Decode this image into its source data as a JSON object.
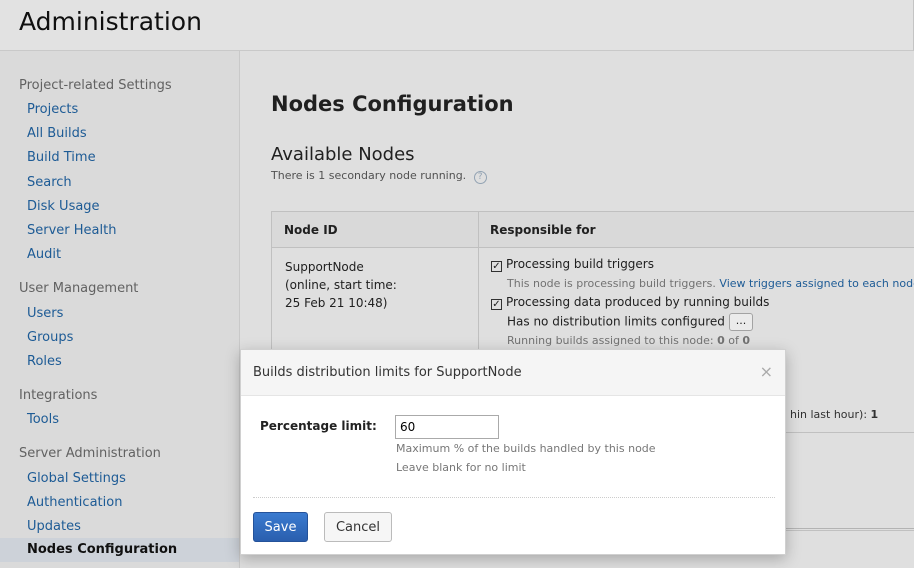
{
  "header": {
    "title": "Administration"
  },
  "sidebar": {
    "sections": [
      {
        "title": "Project-related Settings",
        "items": [
          "Projects",
          "All Builds",
          "Build Time",
          "Search",
          "Disk Usage",
          "Server Health",
          "Audit"
        ]
      },
      {
        "title": "User Management",
        "items": [
          "Users",
          "Groups",
          "Roles"
        ]
      },
      {
        "title": "Integrations",
        "items": [
          "Tools"
        ]
      },
      {
        "title": "Server Administration",
        "items": [
          "Global Settings",
          "Authentication",
          "Updates",
          "Nodes Configuration"
        ]
      }
    ],
    "active": "Nodes Configuration"
  },
  "main": {
    "title": "Nodes Configuration",
    "subtitle": "Available Nodes",
    "info": "There is 1 secondary node running.",
    "help_icon": "question-circle-icon",
    "table": {
      "headers": [
        "Node ID",
        "Responsible for"
      ],
      "node": {
        "id": "SupportNode",
        "status": "(online, start time:",
        "start": "25 Feb 21 10:48)"
      },
      "resp": {
        "triggers_label": "Processing build triggers",
        "triggers_desc": "This node is processing build triggers.",
        "triggers_link": "View triggers assigned to each node.",
        "data_label": "Processing data produced by running builds",
        "limits_text": "Has no distribution limits configured",
        "limits_btn": "...",
        "running_prefix": "Running builds assigned to this node:",
        "running_a": "0",
        "running_of": "of",
        "running_b": "0",
        "partial_text": "hin last hour):",
        "partial_value": "1"
      }
    }
  },
  "dialog": {
    "title": "Builds distribution limits for SupportNode",
    "close": "×",
    "field_label": "Percentage limit:",
    "field_value": "60",
    "hint1": "Maximum % of the builds handled by this node",
    "hint2": "Leave blank for no limit",
    "save": "Save",
    "cancel": "Cancel",
    "accent": "#2e6bbf"
  }
}
